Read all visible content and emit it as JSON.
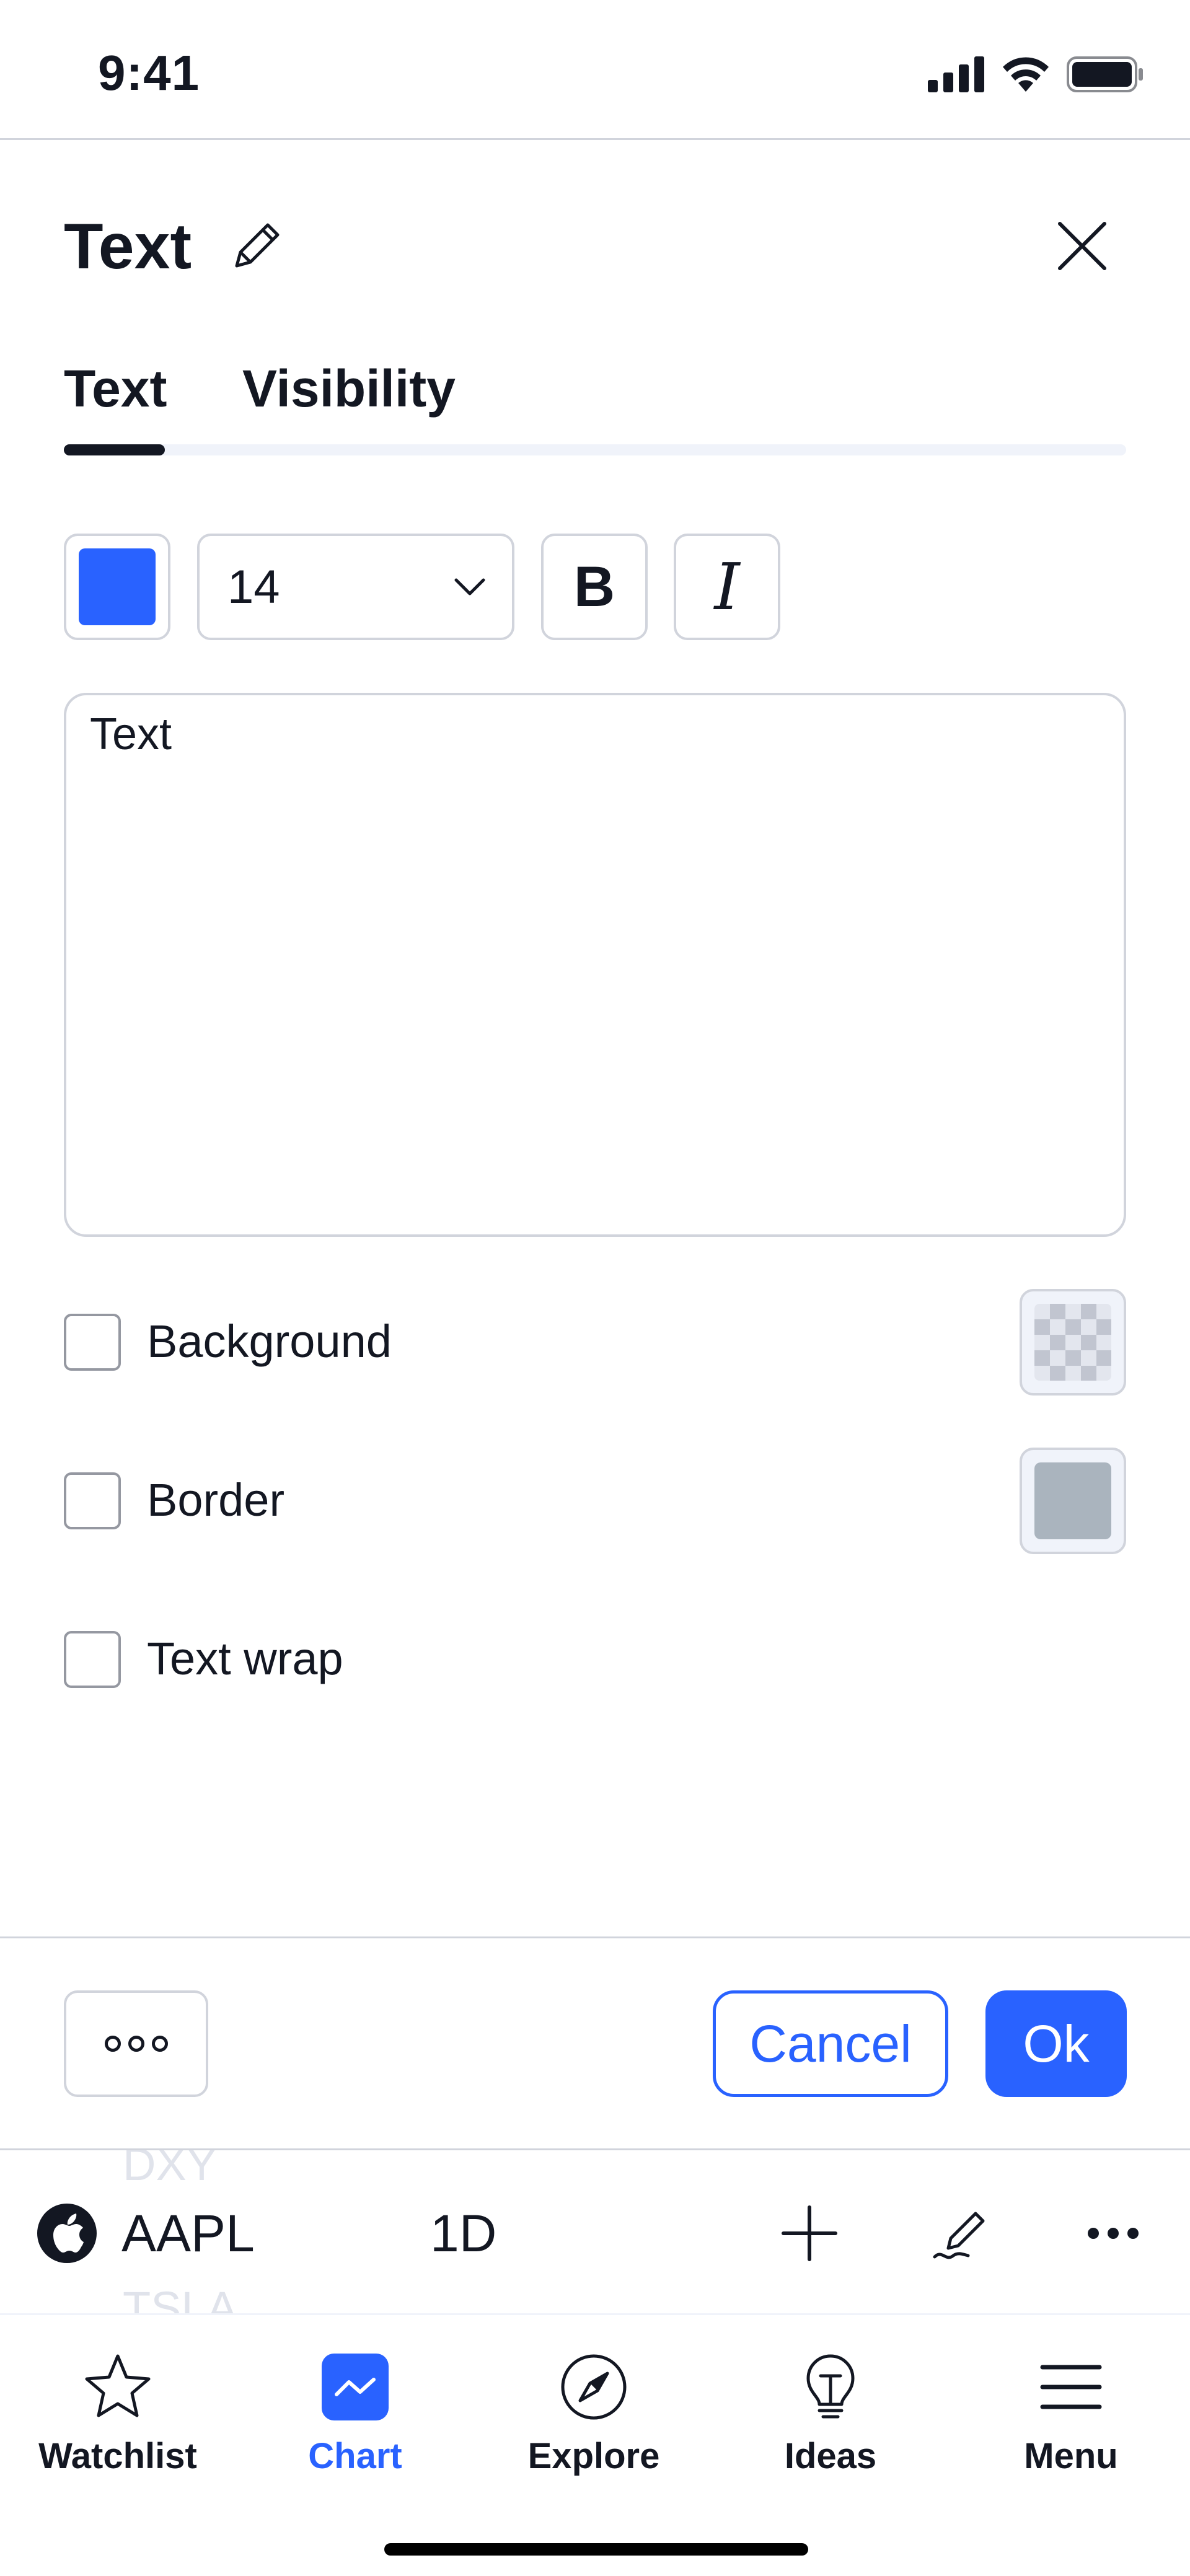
{
  "status_bar": {
    "time": "9:41"
  },
  "dialog": {
    "title": "Text",
    "tabs": [
      {
        "label": "Text",
        "active": true
      },
      {
        "label": "Visibility",
        "active": false
      }
    ],
    "toolbar": {
      "text_color": "#2962ff",
      "font_size": "14",
      "bold_label": "B",
      "italic_label": "I"
    },
    "text_value": "Text",
    "options": [
      {
        "label": "Background",
        "checked": false,
        "swatch": "transparent-checker"
      },
      {
        "label": "Border",
        "checked": false,
        "swatch": "#aab4be"
      },
      {
        "label": "Text wrap",
        "checked": false
      }
    ],
    "footer": {
      "more_label": "ooo",
      "cancel_label": "Cancel",
      "ok_label": "Ok"
    }
  },
  "chart_toolbar": {
    "ghost_symbol_above": "DXY",
    "symbol": "AAPL",
    "ghost_symbol_below": "TSLA",
    "interval": "1D"
  },
  "bottom_nav": {
    "items": [
      {
        "label": "Watchlist",
        "icon": "star-icon",
        "active": false
      },
      {
        "label": "Chart",
        "icon": "chart-icon",
        "active": true
      },
      {
        "label": "Explore",
        "icon": "compass-icon",
        "active": false
      },
      {
        "label": "Ideas",
        "icon": "lightbulb-icon",
        "active": false
      },
      {
        "label": "Menu",
        "icon": "hamburger-icon",
        "active": false
      }
    ]
  },
  "colors": {
    "accent": "#2962ff",
    "text": "#131722",
    "border": "#d1d4dc"
  }
}
